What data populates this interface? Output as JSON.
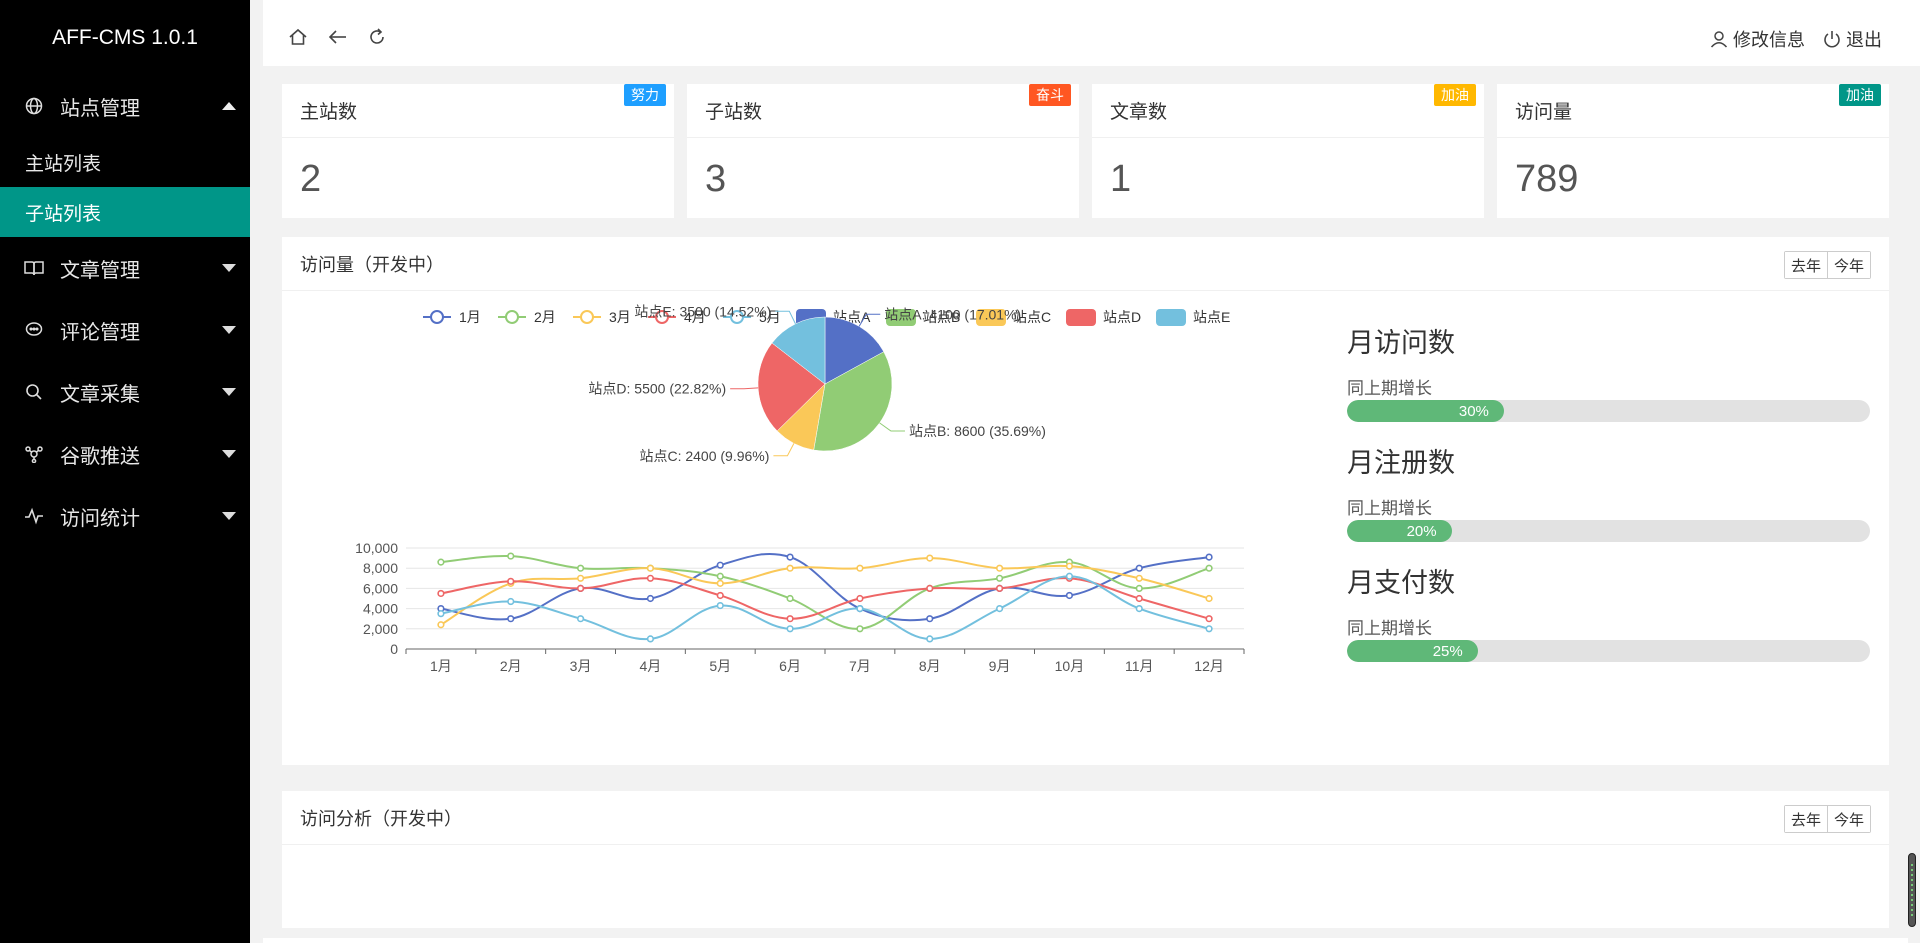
{
  "app": {
    "title": "AFF-CMS 1.0.1"
  },
  "sidebar": {
    "groups": [
      {
        "label": "站点管理",
        "icon": "globe-icon",
        "expanded": true,
        "children": [
          {
            "label": "主站列表",
            "active": false
          },
          {
            "label": "子站列表",
            "active": true
          }
        ]
      },
      {
        "label": "文章管理",
        "icon": "book-icon",
        "expanded": false
      },
      {
        "label": "评论管理",
        "icon": "comment-icon",
        "expanded": false
      },
      {
        "label": "文章采集",
        "icon": "search-icon",
        "expanded": false
      },
      {
        "label": "谷歌推送",
        "icon": "share-icon",
        "expanded": false
      },
      {
        "label": "访问统计",
        "icon": "pulse-icon",
        "expanded": false
      }
    ]
  },
  "header": {
    "profile_label": "修改信息",
    "logout_label": "退出"
  },
  "stats": [
    {
      "label": "主站数",
      "badge": "努力",
      "badge_color": "#1e9fff",
      "value": "2"
    },
    {
      "label": "子站数",
      "badge": "奋斗",
      "badge_color": "#ff5722",
      "value": "3"
    },
    {
      "label": "文章数",
      "badge": "加油",
      "badge_color": "#ffb800",
      "value": "1"
    },
    {
      "label": "访问量",
      "badge": "加油",
      "badge_color": "#009688",
      "value": "789"
    }
  ],
  "visits_panel": {
    "title": "访问量（开发中）",
    "btn_last": "去年",
    "btn_this": "今年",
    "progress": [
      {
        "title": "月访问数",
        "label": "同上期增长",
        "value": 30,
        "value_label": "30%"
      },
      {
        "title": "月注册数",
        "label": "同上期增长",
        "value": 20,
        "value_label": "20%"
      },
      {
        "title": "月支付数",
        "label": "同上期增长",
        "value": 25,
        "value_label": "25%"
      }
    ]
  },
  "analysis_panel": {
    "title": "访问分析（开发中）",
    "btn_last": "去年",
    "btn_this": "今年"
  },
  "chart_data": [
    {
      "type": "pie",
      "slices": [
        {
          "name": "站点A",
          "value": 4100,
          "percent": "17.01%",
          "color": "#5470c6"
        },
        {
          "name": "站点B",
          "value": 8600,
          "percent": "35.69%",
          "color": "#91cc75"
        },
        {
          "name": "站点C",
          "value": 2400,
          "percent": "9.96%",
          "color": "#fac858"
        },
        {
          "name": "站点D",
          "value": 5500,
          "percent": "22.82%",
          "color": "#ee6666"
        },
        {
          "name": "站点E",
          "value": 3500,
          "percent": "14.52%",
          "color": "#73c0de"
        }
      ]
    },
    {
      "type": "line",
      "x": [
        "1月",
        "2月",
        "3月",
        "4月",
        "5月",
        "6月",
        "7月",
        "8月",
        "9月",
        "10月",
        "11月",
        "12月"
      ],
      "ylim": [
        0,
        10000
      ],
      "yticks": [
        "0",
        "2,000",
        "4,000",
        "6,000",
        "8,000",
        "10,000"
      ],
      "series": [
        {
          "name": "1月",
          "color": "#5470c6",
          "values": [
            4000,
            3000,
            6000,
            5000,
            8300,
            9100,
            4000,
            3000,
            6000,
            5300,
            8000,
            9100
          ]
        },
        {
          "name": "2月",
          "color": "#91cc75",
          "values": [
            8600,
            9200,
            8000,
            8000,
            7200,
            5000,
            2000,
            6000,
            7000,
            8600,
            6000,
            8000
          ]
        },
        {
          "name": "3月",
          "color": "#fac858",
          "values": [
            2400,
            6500,
            7000,
            8000,
            6500,
            8000,
            8000,
            9000,
            8000,
            8200,
            7000,
            5000
          ]
        },
        {
          "name": "4月",
          "color": "#ee6666",
          "values": [
            5500,
            6700,
            6000,
            7000,
            5300,
            3000,
            5000,
            6000,
            6000,
            7000,
            5000,
            3000
          ]
        },
        {
          "name": "5月",
          "color": "#73c0de",
          "values": [
            3500,
            4700,
            3000,
            1000,
            4300,
            2000,
            4000,
            1000,
            4000,
            7200,
            4000,
            2000
          ]
        }
      ]
    }
  ]
}
